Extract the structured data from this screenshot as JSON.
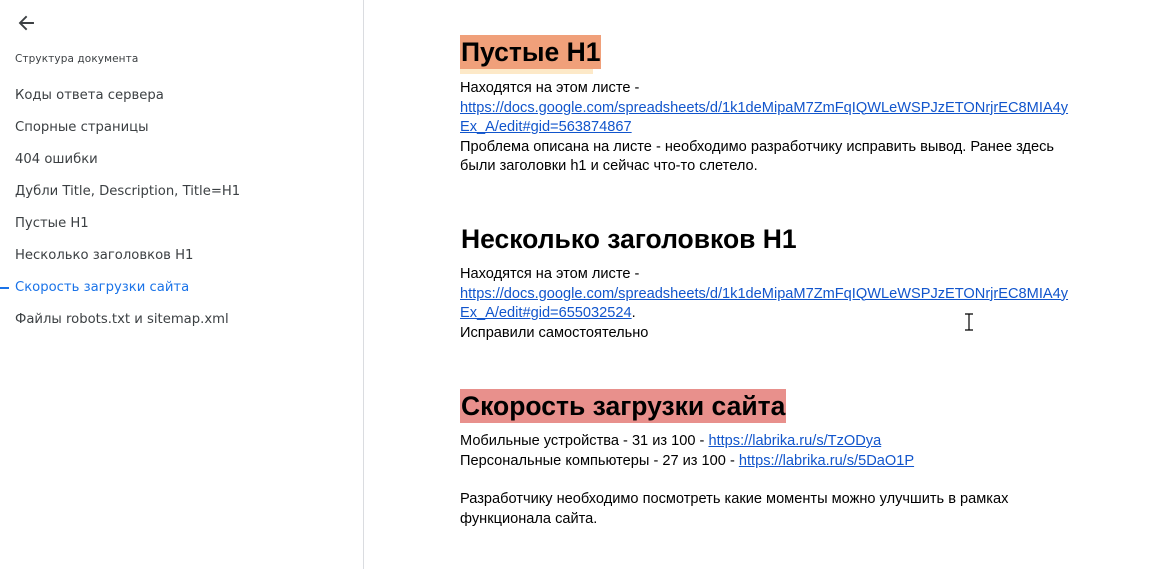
{
  "sidebar": {
    "back_icon": "arrow-left-icon",
    "title": "Структура документа",
    "items": [
      {
        "label": "Коды ответа сервера",
        "active": false
      },
      {
        "label": "Спорные страницы",
        "active": false
      },
      {
        "label": "404 ошибки",
        "active": false
      },
      {
        "label": "Дубли Title, Description, Title=H1",
        "active": false
      },
      {
        "label": "Пустые H1",
        "active": false
      },
      {
        "label": "Несколько заголовков H1",
        "active": false
      },
      {
        "label": "Скорость загрузки сайта",
        "active": true
      },
      {
        "label": "Файлы robots.txt и sitemap.xml",
        "active": false
      }
    ],
    "active_color": "#1a73e8"
  },
  "document": {
    "sections": [
      {
        "heading": "Пустые H1",
        "highlight": "#f0a07a",
        "intro": "Находятся на этом листе -",
        "link": "https://docs.google.com/spreadsheets/d/1k1deMipaM7ZmFqIQWLeWSPJzETONrjrEC8MIA4yEx_A/edit#gid=563874867",
        "note": "Проблема описана на листе - необходимо разработчику исправить вывод. Ранее здесь были заголовки h1 и сейчас что-то слетело."
      },
      {
        "heading": "Несколько заголовков H1",
        "intro": "Находятся на этом листе -",
        "link": "https://docs.google.com/spreadsheets/d/1k1deMipaM7ZmFqIQWLeWSPJzETONrjrEC8MIA4yEx_A/edit#gid=655032524",
        "link_suffix": ".",
        "note": "Исправили самостоятельно"
      },
      {
        "heading": "Скорость загрузки сайта",
        "highlight": "#e8908c",
        "mobile_text": "Мобильные устройства - 31 из 100 - ",
        "mobile_link": "https://labrika.ru/s/TzODya",
        "desktop_text": "Персональные компьютеры - 27 из 100 - ",
        "desktop_link": "https://labrika.ru/s/5DaO1P",
        "note": "Разработчику необходимо посмотреть какие моменты можно улучшить в рамках функционала сайта."
      }
    ]
  },
  "cursor_icon": "text-cursor-icon"
}
